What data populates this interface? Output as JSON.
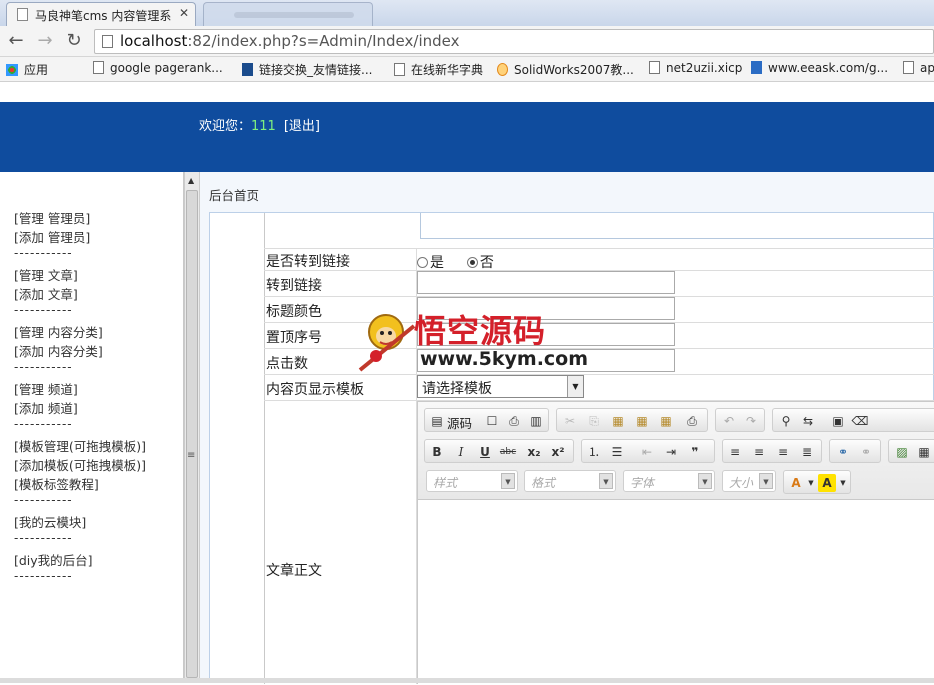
{
  "browser": {
    "active_tab_title": "马良神笔cms 内容管理系",
    "url_host": "localhost",
    "url_rest": ":82/index.php?s=Admin/Index/index",
    "bookmarks": [
      "应用",
      "google pagerank...",
      "链接交换_友情链接...",
      "在线新华字典",
      "SolidWorks2007教...",
      "net2uzii.xicp",
      "www.eeask.com/g...",
      "ap"
    ]
  },
  "header": {
    "welcome_label": "欢迎您：",
    "username": "111",
    "logout": "[退出]"
  },
  "sidebar": {
    "items": [
      "[管理 管理员]",
      "[添加 管理员]",
      "-----------",
      "[管理 文章]",
      "[添加 文章]",
      "-----------",
      "[管理 内容分类]",
      "[添加 内容分类]",
      "-----------",
      "[管理 频道]",
      "[添加 频道]",
      "-----------",
      "[模板管理(可拖拽模板)]",
      "[添加模板(可拖拽模板)]",
      "[模板标签教程]",
      "-----------",
      "[我的云模块]",
      "-----------",
      "[diy我的后台]",
      "-----------"
    ]
  },
  "main": {
    "breadcrumb": "后台首页",
    "form": {
      "redirect_label": "是否转到链接",
      "radio_yes": "是",
      "radio_no": "否",
      "radio_selected": "否",
      "link_label": "转到链接",
      "title_color_label": "标题颜色",
      "top_order_label": "置顶序号",
      "clicks_label": "点击数",
      "template_label": "内容页显示模板",
      "template_select": "请选择模板",
      "body_label": "文章正文"
    },
    "editor": {
      "source_label": "源码",
      "style_dropdown": "样式",
      "format_dropdown": "格式",
      "font_dropdown": "字体",
      "size_dropdown": "大小"
    }
  },
  "watermark": {
    "title": "悟空源码",
    "url": "www.5kym.com"
  }
}
